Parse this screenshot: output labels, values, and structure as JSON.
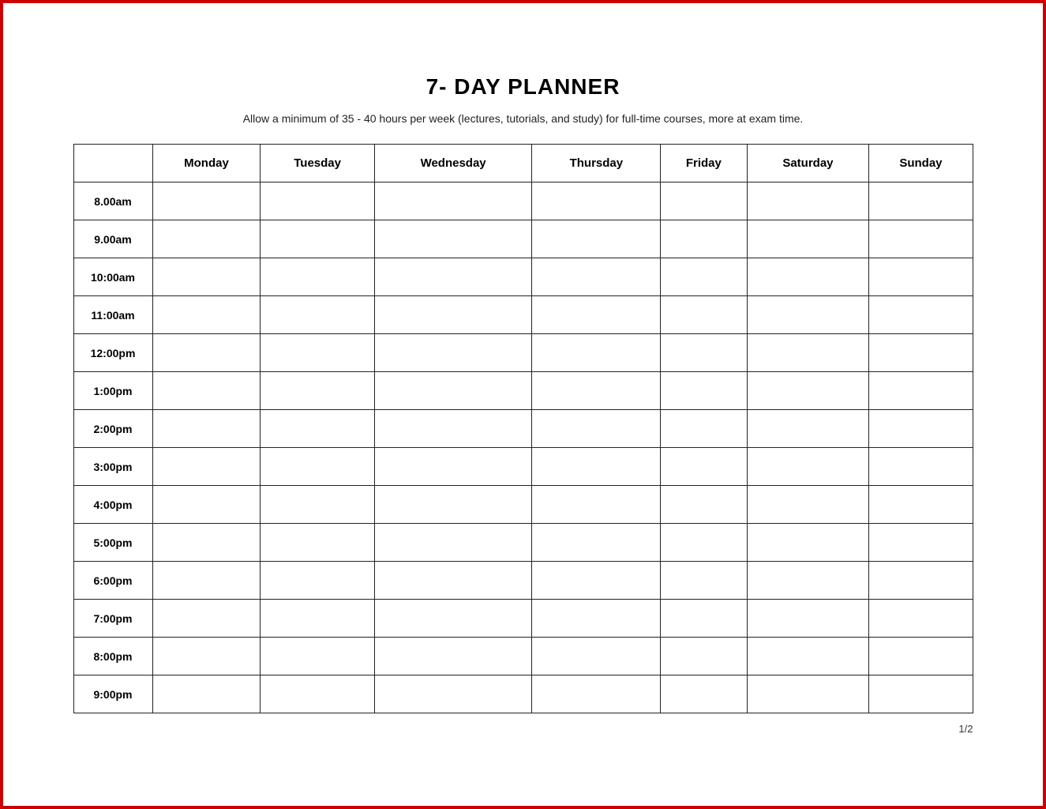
{
  "title": "7- DAY PLANNER",
  "subtitle": "Allow a minimum of 35 - 40 hours per week (lectures, tutorials, and study) for full-time courses, more at exam time.",
  "page_number": "1/2",
  "columns": {
    "time_header": "",
    "days": [
      "Monday",
      "Tuesday",
      "Wednesday",
      "Thursday",
      "Friday",
      "Saturday",
      "Sunday"
    ]
  },
  "time_slots": [
    "8.00am",
    "9.00am",
    "10:00am",
    "11:00am",
    "12:00pm",
    "1:00pm",
    "2:00pm",
    "3:00pm",
    "4:00pm",
    "5:00pm",
    "6:00pm",
    "7:00pm",
    "8:00pm",
    "9:00pm"
  ]
}
